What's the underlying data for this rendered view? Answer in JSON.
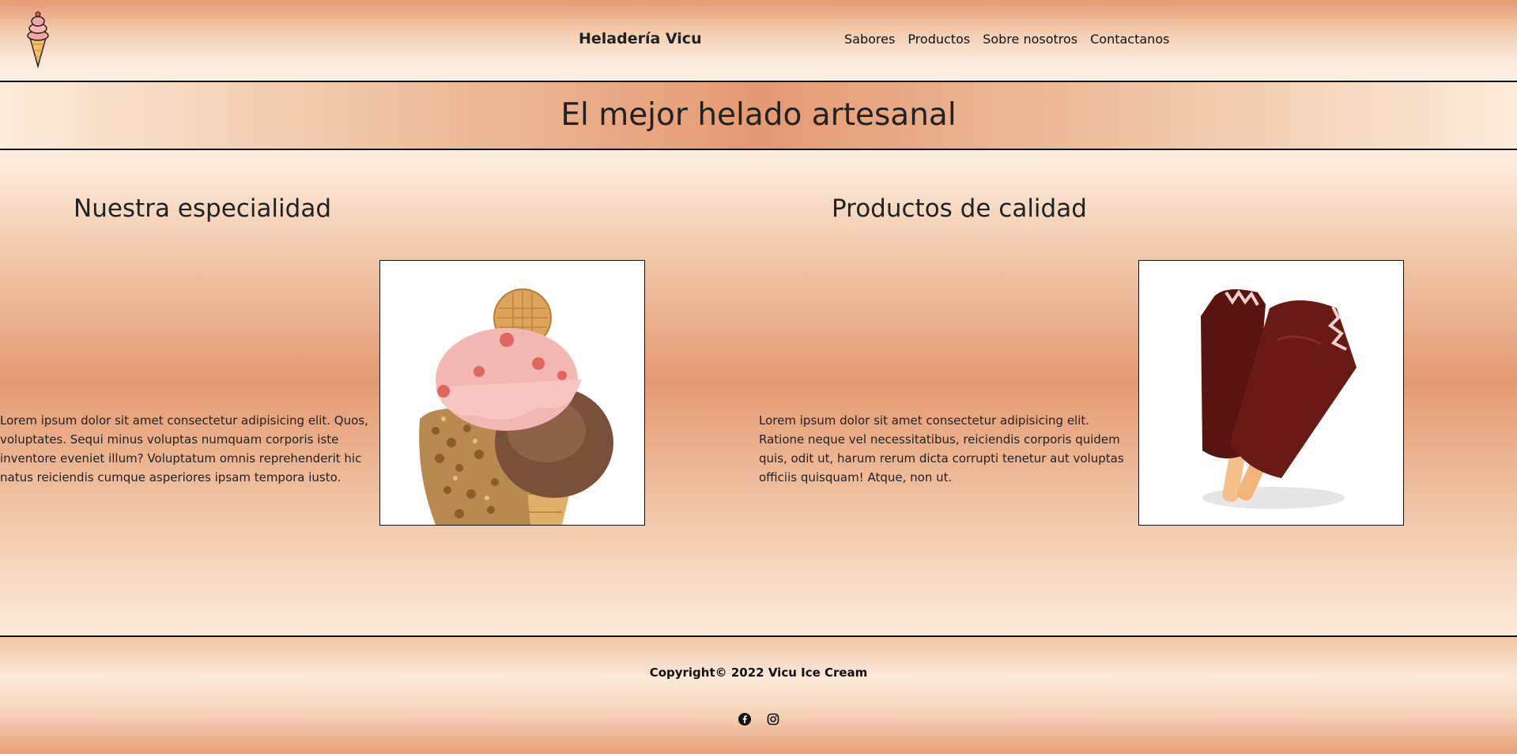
{
  "header": {
    "brand": "Heladería Vicu",
    "nav": [
      "Sabores",
      "Productos",
      "Sobre nosotros",
      "Contactanos"
    ]
  },
  "banner": {
    "title": "El mejor helado artesanal"
  },
  "sections": [
    {
      "title": "Nuestra especialidad",
      "text": "Lorem ipsum dolor sit amet consectetur adipisicing elit. Quos, voluptates. Sequi minus voluptas numquam corporis iste inventore eveniet illum? Voluptatum omnis reprehenderit hic natus reiciendis cumque asperiores ipsam tempora iusto.",
      "image": "ice-cream-cone-photo"
    },
    {
      "title": "Productos de calidad",
      "text": "Lorem ipsum dolor sit amet consectetur adipisicing elit. Ratione neque vel necessitatibus, reiciendis corporis quidem quis, odit ut, harum rerum dicta corrupti tenetur aut voluptas officiis quisquam! Atque, non ut.",
      "image": "chocolate-popsicles-photo"
    }
  ],
  "footer": {
    "copyright": "Copyright© 2022 Vicu Ice Cream",
    "social": [
      "facebook-icon",
      "instagram-icon"
    ]
  },
  "colors": {
    "accent": "#e49a72",
    "light": "#fdf0e2",
    "border": "#111111"
  }
}
